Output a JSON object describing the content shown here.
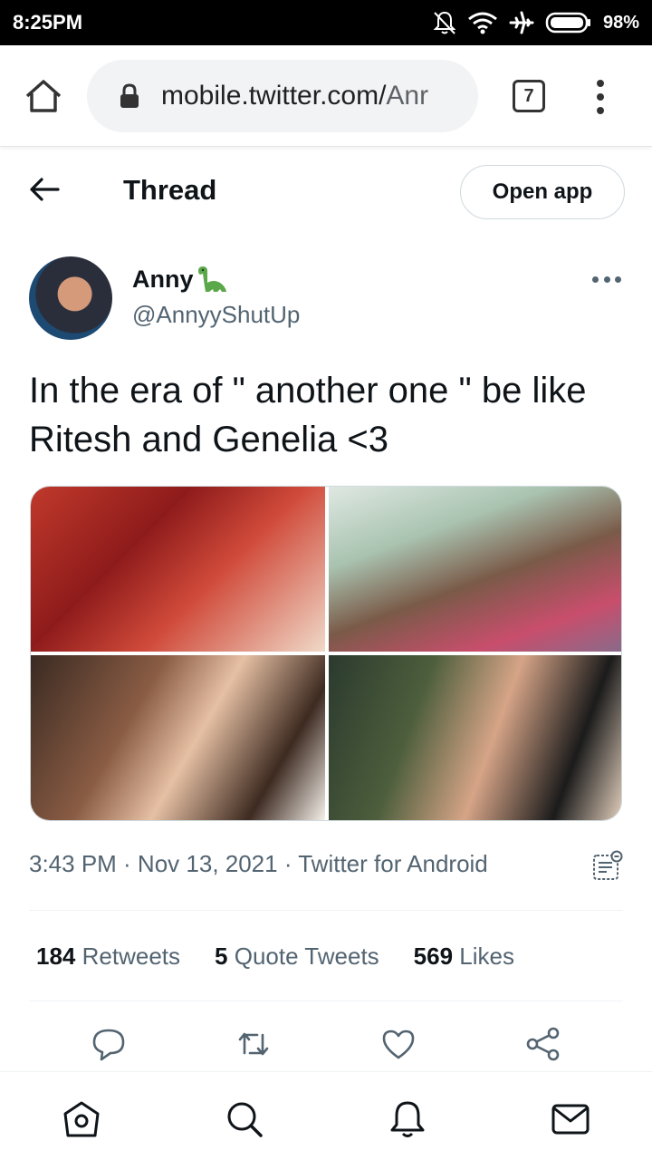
{
  "status_bar": {
    "time": "8:25PM",
    "battery_pct": "98%",
    "icons": [
      "mute-icon",
      "wifi-icon",
      "airplane-icon",
      "battery-icon"
    ]
  },
  "browser": {
    "url_host": "mobile.twitter.com/",
    "url_path": "Anr",
    "tab_count": "7"
  },
  "header": {
    "title": "Thread",
    "open_app_label": "Open app"
  },
  "tweet": {
    "author_name": "Anny",
    "author_handle": "@AnnyyShutUp",
    "text": "In the era of \" another one \" be like Ritesh and Genelia <3",
    "meta": "3:43 PM · Nov 13, 2021 · Twitter for Android",
    "stats": {
      "retweets_count": "184",
      "retweets_label": "Retweets",
      "quotes_count": "5",
      "quotes_label": "Quote Tweets",
      "likes_count": "569",
      "likes_label": "Likes"
    }
  },
  "colors": {
    "text_primary": "#0f1419",
    "text_secondary": "#536471",
    "divider": "#eff3f4",
    "icon_blue": "#1d9bf0"
  }
}
